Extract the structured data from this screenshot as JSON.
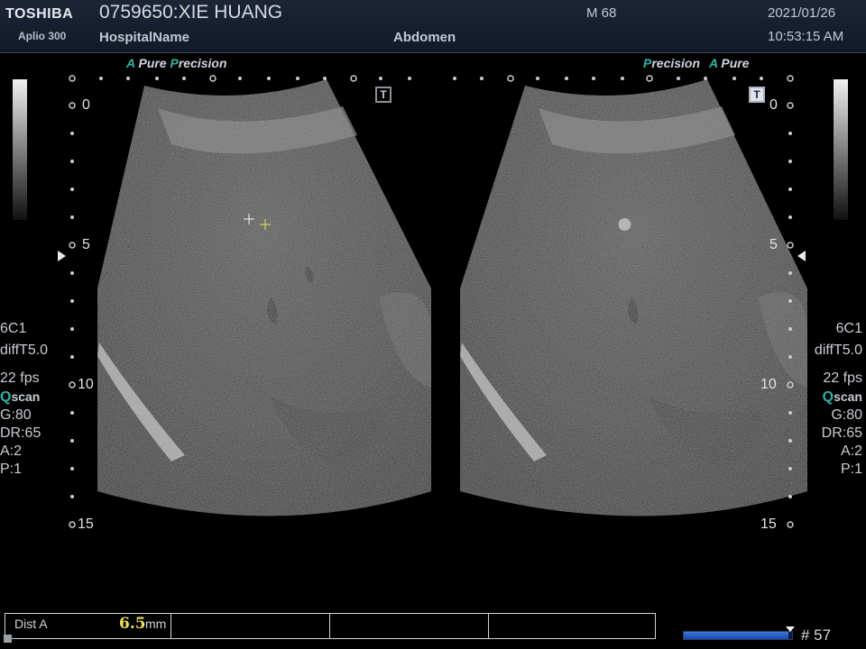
{
  "header": {
    "brand": "TOSHIBA",
    "model": "Aplio 300",
    "patient": "0759650:XIE HUANG",
    "hospital": "HospitalName",
    "exam": "Abdomen",
    "sex_age": "M 68",
    "date": "2021/01/26",
    "time": "10:53:15 AM"
  },
  "left_features": {
    "a": "A",
    "pure": "Pure",
    "p": "P",
    "precision": "recision"
  },
  "right_features": {
    "p": "P",
    "precision": "recision",
    "a": "A",
    "pure": "Pure"
  },
  "params": {
    "probe": "6C1",
    "mode": "diffT5.0",
    "fps": "22 fps",
    "qscan_q": "Q",
    "qscan": "scan",
    "gain": "G:80",
    "dr": "DR:65",
    "a": "A:2",
    "p": "P:1"
  },
  "depth_labels": {
    "d0": "0",
    "d5": "5",
    "d10": "10",
    "d15": "15"
  },
  "t_icon": "T",
  "measurement": {
    "label": "Dist A",
    "value": "6.5",
    "unit": "mm"
  },
  "cine": {
    "fraction": 0.97,
    "frame": "# 57"
  }
}
